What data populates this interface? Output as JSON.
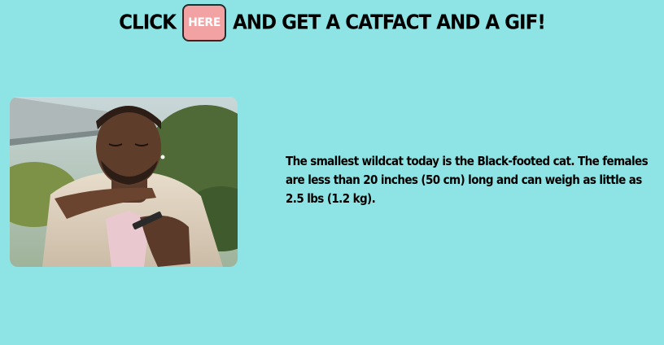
{
  "header": {
    "prefix": "CLICK",
    "button_label": "HERE",
    "suffix": "AND GET A CATFACT AND A GIF!"
  },
  "gif": {
    "alt": "animated gif"
  },
  "catfact": {
    "text": "The smallest wildcat today is the Black-footed cat. The females are less than 20 inches (50 cm) long and can weigh as little as 2.5 lbs (1.2 kg)."
  },
  "colors": {
    "background": "#8ee4e4",
    "button": "#f2a2a2"
  }
}
